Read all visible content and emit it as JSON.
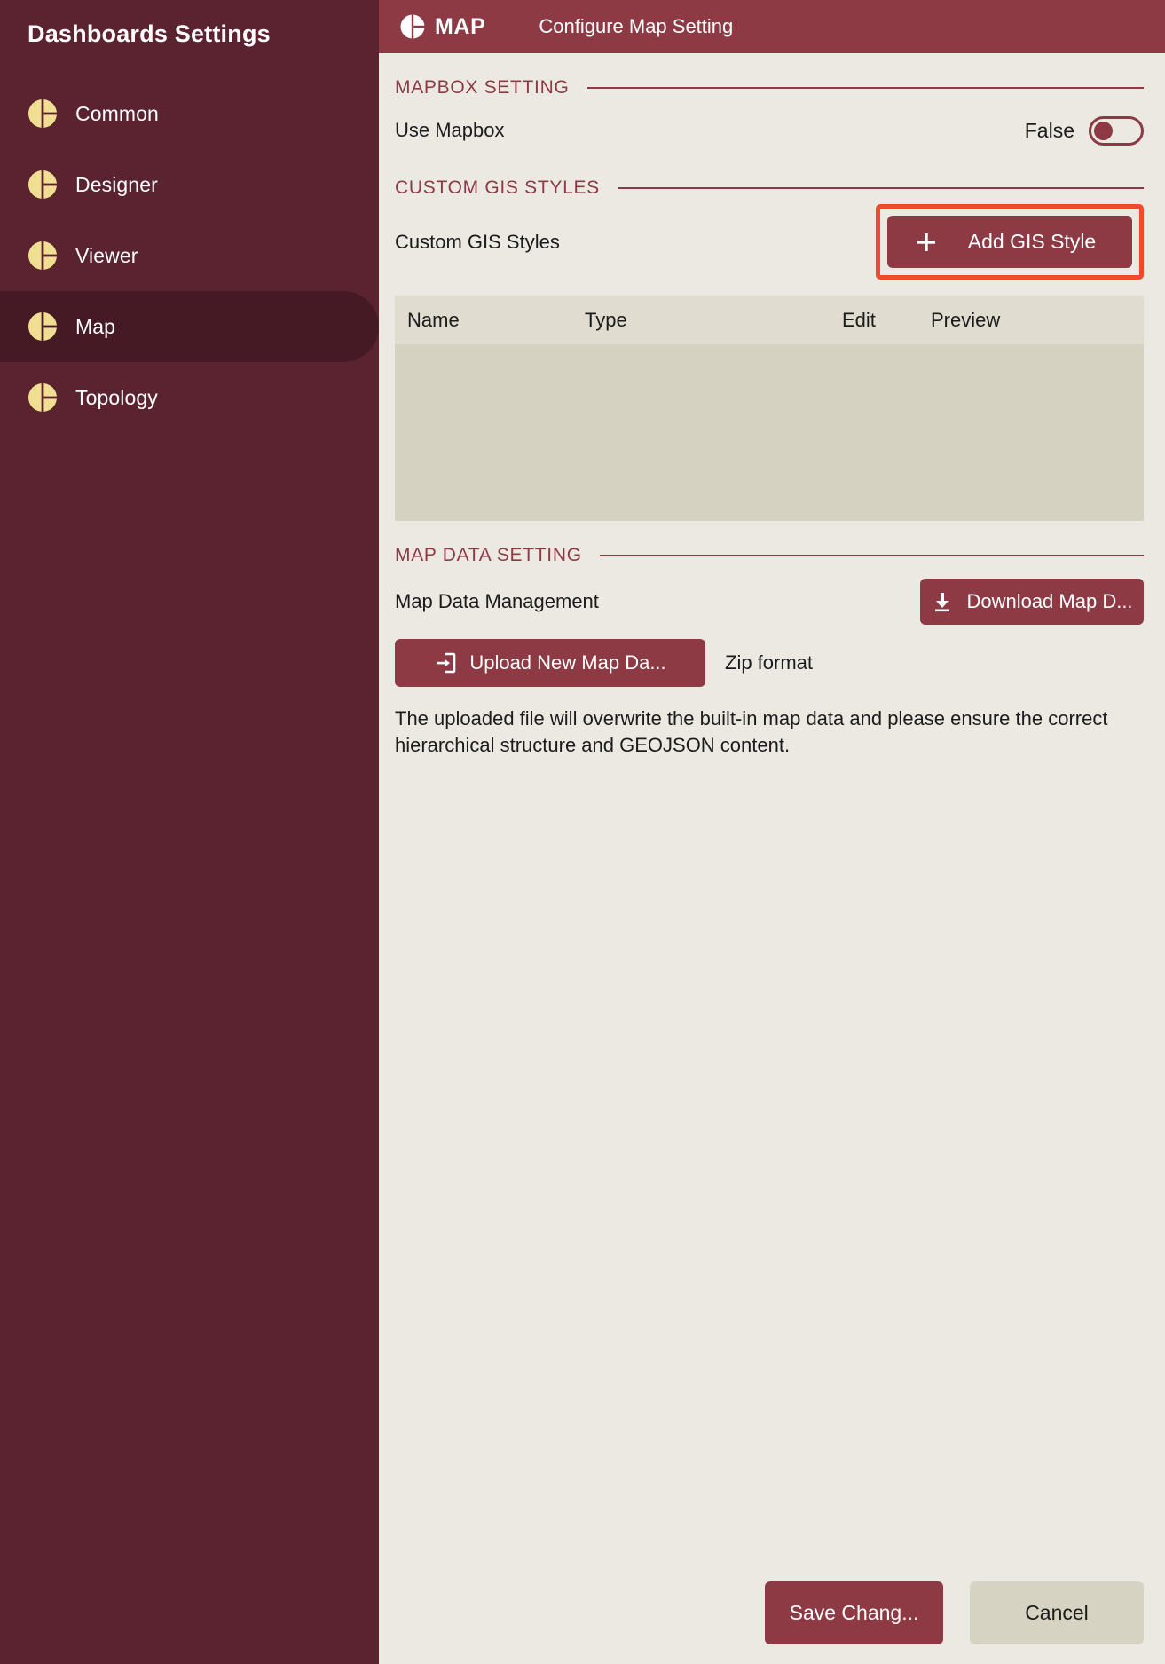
{
  "sidebar": {
    "title": "Dashboards Settings",
    "items": [
      {
        "label": "Common",
        "icon": "pie-segment-icon",
        "active": false
      },
      {
        "label": "Designer",
        "icon": "pie-segment-icon",
        "active": false
      },
      {
        "label": "Viewer",
        "icon": "pie-segment-icon",
        "active": false
      },
      {
        "label": "Map",
        "icon": "pie-segment-icon",
        "active": true
      },
      {
        "label": "Topology",
        "icon": "pie-segment-icon",
        "active": false
      }
    ]
  },
  "topbar": {
    "brand_icon": "pie-segment-icon",
    "brand": "MAP",
    "subtitle": "Configure Map Setting"
  },
  "sections": {
    "mapbox": {
      "heading": "MAPBOX SETTING",
      "use_mapbox_label": "Use Mapbox",
      "use_mapbox_value": "False",
      "use_mapbox_state": "off"
    },
    "custom_gis": {
      "heading": "CUSTOM GIS STYLES",
      "row_label": "Custom GIS Styles",
      "add_button": "Add GIS Style",
      "add_button_icon": "plus-icon",
      "highlighted": "true",
      "table": {
        "columns": [
          "Name",
          "Type",
          "Edit",
          "Preview"
        ],
        "rows": []
      }
    },
    "map_data": {
      "heading": "MAP DATA SETTING",
      "row_label": "Map Data Management",
      "download_button": "Download Map D...",
      "download_icon": "download-icon",
      "upload_button": "Upload New Map Da...",
      "upload_icon": "import-arrow-box-icon",
      "zip_note": "Zip format",
      "description": "The uploaded file will overwrite the built-in map data and please ensure the correct hierarchical structure and GEOJSON content."
    }
  },
  "footer": {
    "save_label": "Save Chang...",
    "cancel_label": "Cancel"
  },
  "colors": {
    "sidebar_bg": "#5a232f",
    "sidebar_active_bg": "#461a24",
    "topbar_bg": "#8d3a45",
    "accent": "#8d3a45",
    "icon_gold": "#f0df92",
    "page_bg": "#ece9e3",
    "table_header_bg": "#e0ddd0",
    "table_body_bg": "#d5d2c2",
    "highlight_border": "#f04a28",
    "secondary_btn_bg": "#d7d3c3"
  }
}
